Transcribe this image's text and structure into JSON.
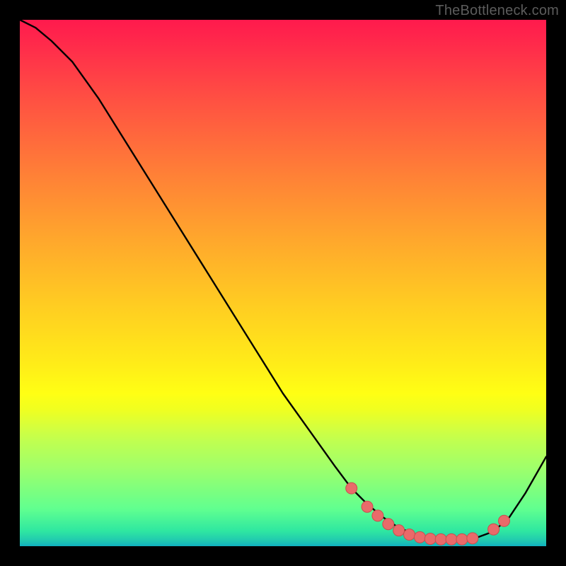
{
  "watermark": "TheBottleneck.com",
  "colors": {
    "page_bg": "#000000",
    "curve": "#000000",
    "marker_fill": "#e96a6a",
    "marker_stroke": "#c94e4e"
  },
  "chart_data": {
    "type": "line",
    "title": "",
    "xlabel": "",
    "ylabel": "",
    "xlim": [
      0,
      100
    ],
    "ylim": [
      0,
      100
    ],
    "grid": false,
    "legend": false,
    "series": [
      {
        "name": "curve",
        "x": [
          0,
          3,
          6,
          10,
          15,
          20,
          25,
          30,
          35,
          40,
          45,
          50,
          55,
          60,
          63,
          66,
          69,
          72,
          75,
          78,
          81,
          84,
          87,
          90,
          93,
          96,
          100
        ],
        "y": [
          100,
          98.5,
          96,
          92,
          85,
          77,
          69,
          61,
          53,
          45,
          37,
          29,
          22,
          15,
          11,
          8,
          5.5,
          3.5,
          2.3,
          1.6,
          1.3,
          1.3,
          1.7,
          2.8,
          5.5,
          10,
          17
        ]
      }
    ],
    "markers": {
      "name": "highlight-points",
      "x": [
        63,
        66,
        68,
        70,
        72,
        74,
        76,
        78,
        80,
        82,
        84,
        86,
        90,
        92
      ],
      "y": [
        11,
        7.5,
        5.8,
        4.2,
        3.0,
        2.2,
        1.7,
        1.4,
        1.3,
        1.3,
        1.3,
        1.5,
        3.2,
        4.8
      ]
    }
  }
}
